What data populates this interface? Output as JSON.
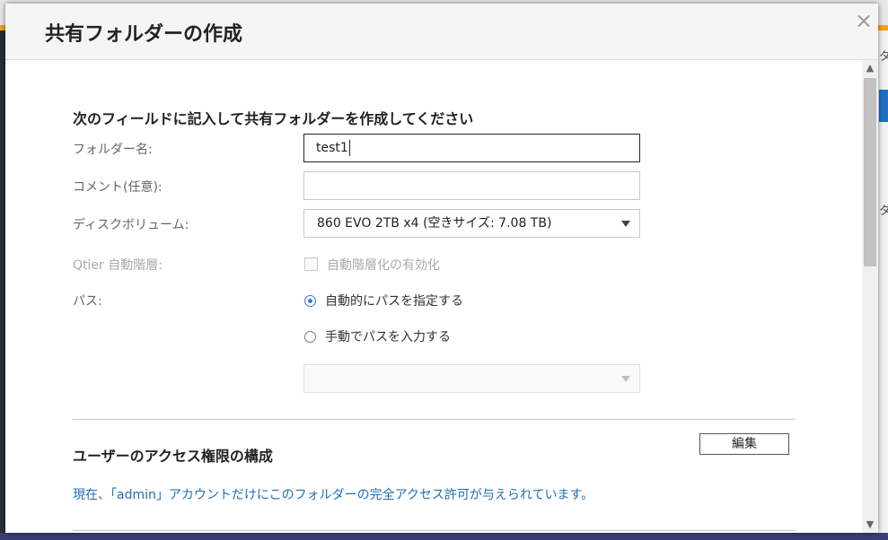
{
  "background": {
    "right_text_1": "タ",
    "right_text_2": "タ"
  },
  "dialog": {
    "title": "共有フォルダーの作成",
    "close_symbol": "×"
  },
  "form": {
    "heading": "次のフィールドに記入して共有フォルダーを作成してください",
    "folder_name": {
      "label": "フォルダー名:",
      "value": "test1"
    },
    "comment": {
      "label": "コメント(任意):",
      "value": ""
    },
    "disk_volume": {
      "label": "ディスクボリューム:",
      "value": "860 EVO 2TB x4 (空きサイズ: 7.08 TB)"
    },
    "qtier": {
      "label": "Qtier 自動階層:",
      "checkbox_label": "自動階層化の有効化",
      "checked": false
    },
    "path": {
      "label": "パス:",
      "option_auto": "自動的にパスを指定する",
      "option_manual": "手動でパスを入力する",
      "selected": "auto",
      "manual_select_value": ""
    }
  },
  "access": {
    "heading": "ユーザーのアクセス権限の構成",
    "edit_label": "編集",
    "info": "現在、「admin」アカウントだけにこのフォルダーの完全アクセス許可が与えられています。"
  },
  "scrollbar": {
    "up": "▲",
    "down": "▼"
  }
}
